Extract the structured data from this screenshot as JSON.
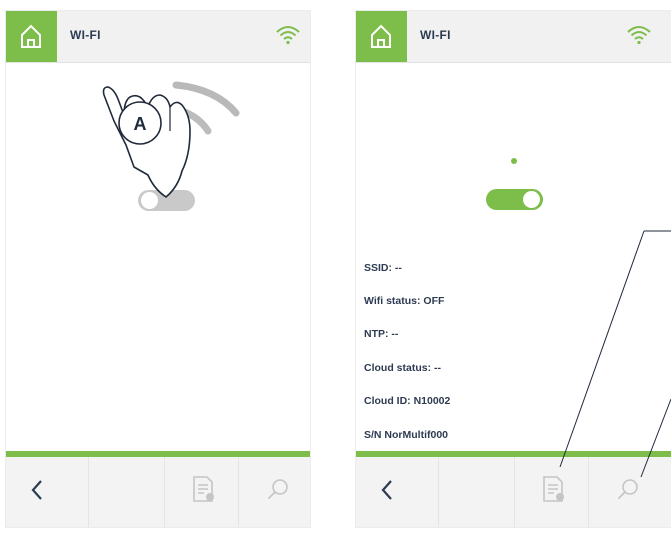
{
  "left_screen": {
    "title": "WI-FI",
    "hand_label": "A",
    "wifi_toggle_state": "off"
  },
  "right_screen": {
    "title": "WI-FI",
    "wifi_toggle_state": "on",
    "info": {
      "ssid": "SSID: --",
      "wifi_status": "Wifi status: OFF",
      "ntp": "NTP: --",
      "cloud_status": "Cloud status: --",
      "cloud_id": "Cloud ID: N10002",
      "serial": "S/N NorMultif000"
    }
  },
  "icons": {
    "home": "home-icon",
    "wifi": "wifi-icon",
    "back": "chevron-left-icon",
    "report": "report-icon",
    "search": "search-icon",
    "hand": "pointing-hand-icon"
  },
  "colors": {
    "accent_green": "#7dbd4a",
    "text_dark": "#2d3b52",
    "toggle_off": "#c9c9c9",
    "bar_bg": "#f1f1f1"
  }
}
